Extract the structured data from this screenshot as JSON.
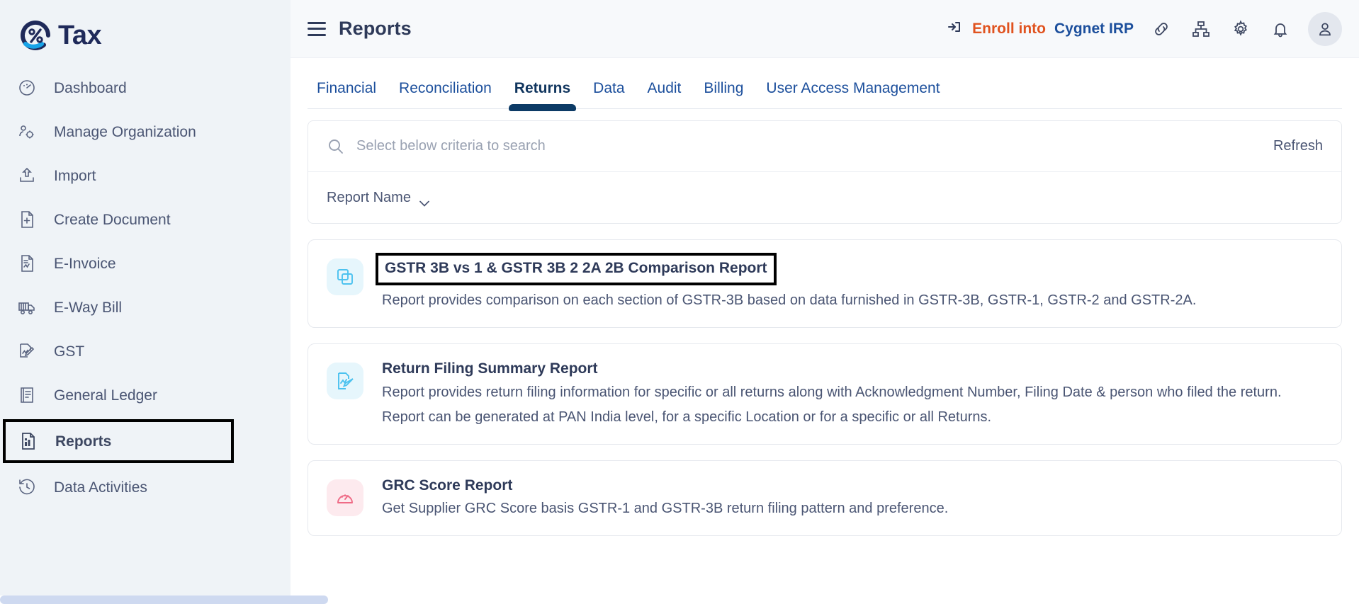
{
  "brand": {
    "name": "Tax",
    "logo_icon": "percent-circle-logo"
  },
  "sidebar": {
    "items": [
      {
        "label": "Dashboard",
        "icon": "speedometer-icon",
        "active": false
      },
      {
        "label": "Manage Organization",
        "icon": "people-gear-icon",
        "active": false
      },
      {
        "label": "Import",
        "icon": "upload-icon",
        "active": false
      },
      {
        "label": "Create Document",
        "icon": "document-plus-icon",
        "active": false
      },
      {
        "label": "E-Invoice",
        "icon": "invoice-document-icon",
        "active": false
      },
      {
        "label": "E-Way Bill",
        "icon": "truck-icon",
        "active": false
      },
      {
        "label": "GST",
        "icon": "document-pencil-icon",
        "active": false
      },
      {
        "label": "General Ledger",
        "icon": "ledger-book-icon",
        "active": false
      },
      {
        "label": "Reports",
        "icon": "bar-chart-document-icon",
        "active": true
      },
      {
        "label": "Data Activities",
        "icon": "clock-history-icon",
        "active": false
      }
    ]
  },
  "topbar": {
    "menu_icon": "hamburger-icon",
    "title": "Reports",
    "enroll": {
      "icon": "enroll-arrow-icon",
      "text_primary": "Enroll into",
      "text_secondary": "Cygnet IRP",
      "color_primary": "#e0531f",
      "color_secondary": "#1c4f9c"
    },
    "icons": [
      {
        "name": "link-icon"
      },
      {
        "name": "sitemap-icon"
      },
      {
        "name": "gear-icon"
      },
      {
        "name": "bell-icon"
      }
    ],
    "avatar": {
      "name": "user-avatar"
    }
  },
  "tabs": [
    {
      "label": "Financial",
      "active": false
    },
    {
      "label": "Reconciliation",
      "active": false
    },
    {
      "label": "Returns",
      "active": true
    },
    {
      "label": "Data",
      "active": false
    },
    {
      "label": "Audit",
      "active": false
    },
    {
      "label": "Billing",
      "active": false
    },
    {
      "label": "User Access Management",
      "active": false
    }
  ],
  "search": {
    "icon": "search-icon",
    "placeholder": "Select below criteria to search",
    "value": "",
    "refresh_label": "Refresh",
    "criteria_label": "Report Name",
    "criteria_chevron": "chevron-down-icon"
  },
  "reports": [
    {
      "title": "GSTR 3B vs 1 & GSTR 3B 2 2A 2B Comparison Report",
      "description": "Report provides comparison on each section of GSTR-3B based on data furnished in GSTR-3B, GSTR-1, GSTR-2 and GSTR-2A.",
      "description2": "",
      "icon": "copy-documents-icon",
      "icon_style": "blue",
      "highlighted": true
    },
    {
      "title": "Return Filing Summary Report",
      "description": "Report provides return filing information for specific or all returns along with Acknowledgment Number, Filing Date & person who filed the return.",
      "description2": "Report can be generated at PAN India level, for a specific Location or for a specific or all Returns.",
      "icon": "document-pencil-icon",
      "icon_style": "blue",
      "highlighted": false
    },
    {
      "title": "GRC Score Report",
      "description": "Get Supplier GRC Score basis GSTR-1 and GSTR-3B return filing pattern and preference.",
      "description2": "",
      "icon": "gauge-icon",
      "icon_style": "pink",
      "highlighted": false
    }
  ],
  "colors": {
    "accent_blue": "#1c4f9c",
    "accent_orange": "#e0531f",
    "tab_active": "#0d3b66",
    "sidebar_bg": "#eff3f7",
    "highlight_box": "#000000"
  }
}
